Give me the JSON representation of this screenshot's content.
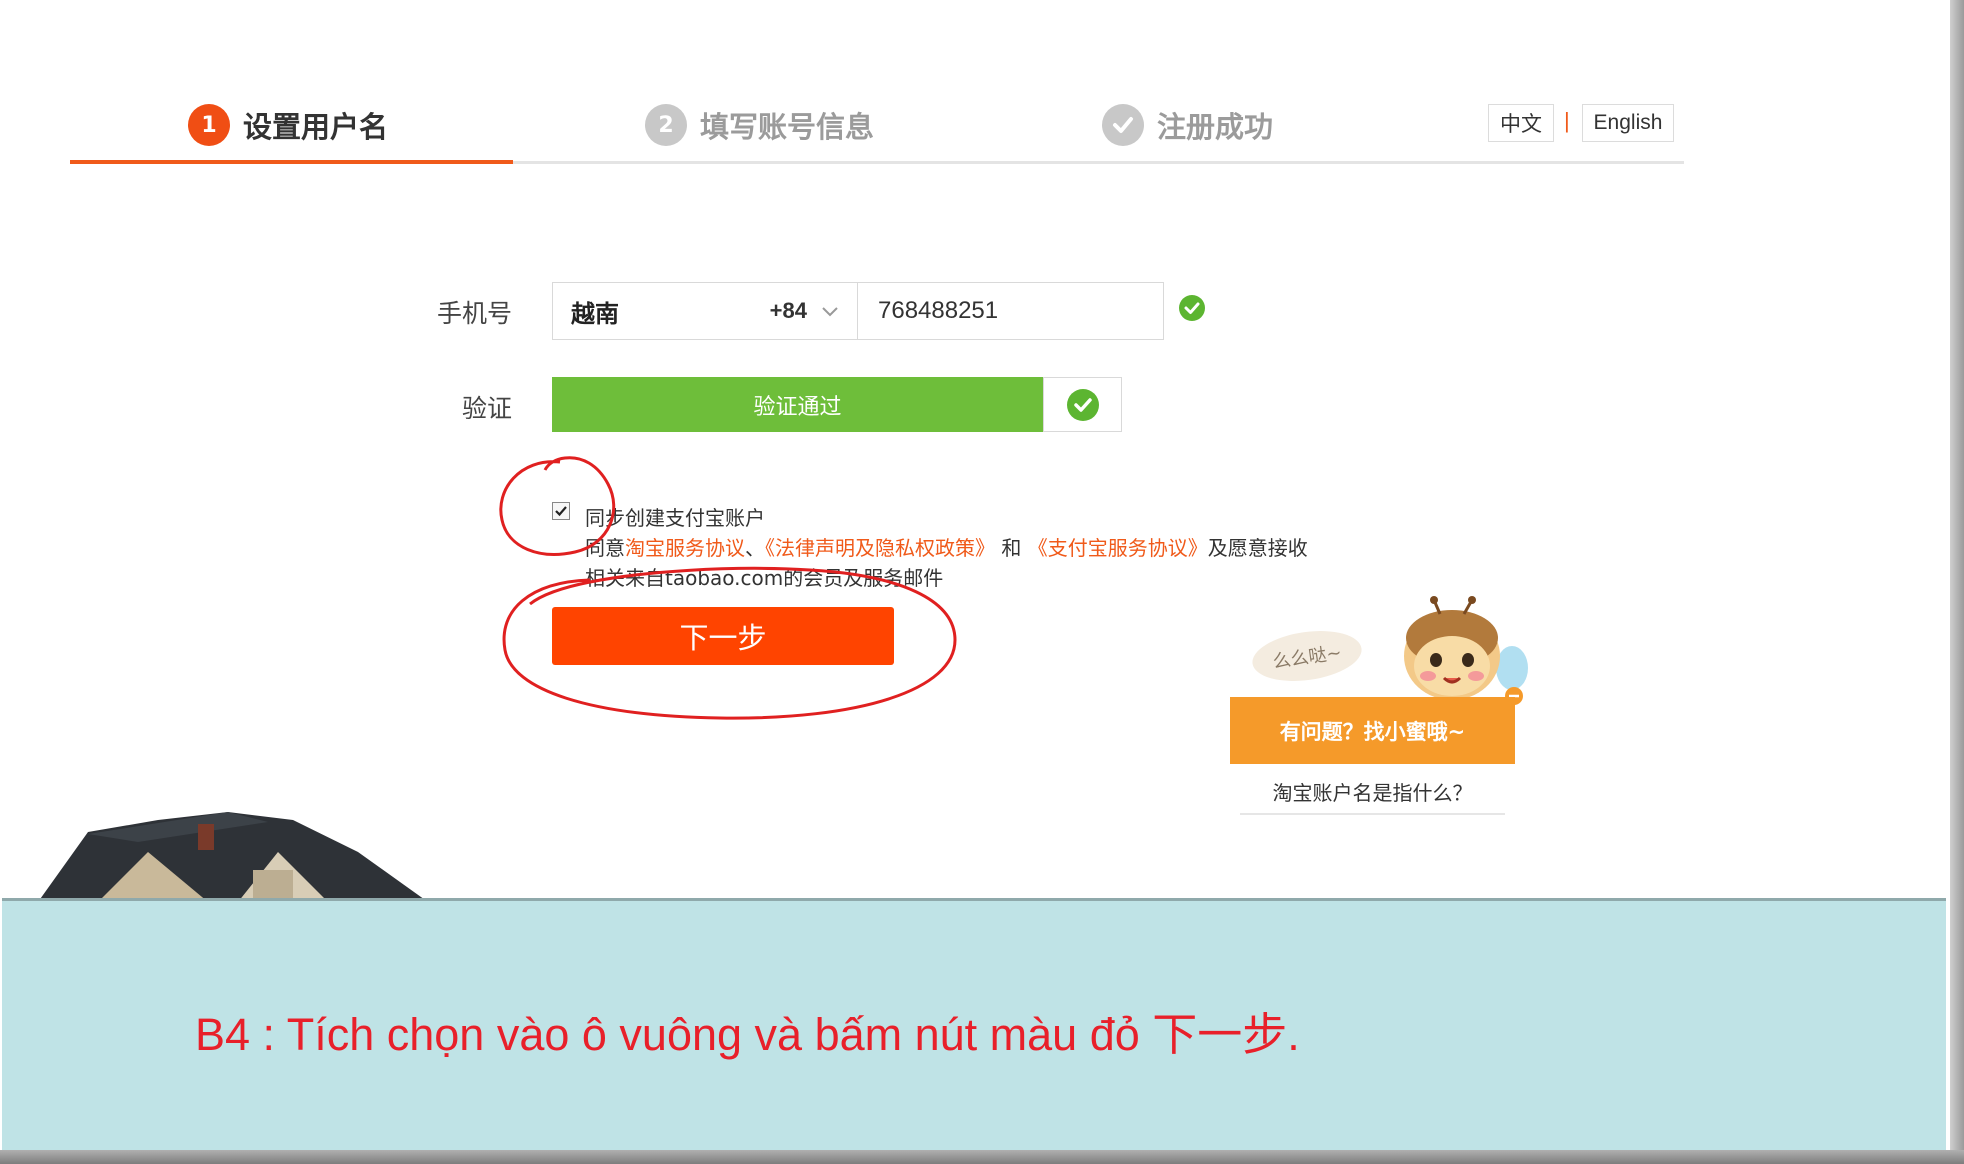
{
  "steps": [
    {
      "number": "1",
      "label": "设置用户名"
    },
    {
      "number": "2",
      "label": "填写账号信息"
    },
    {
      "number": "",
      "label": "注册成功"
    }
  ],
  "language": {
    "zh": "中文",
    "separator": "|",
    "en": "English"
  },
  "form": {
    "phone_label": "手机号",
    "country": "越南",
    "country_code": "+84",
    "phone_value": "768488251",
    "verify_label": "验证",
    "verify_status": "验证通过",
    "alipay_checked": true,
    "alipay_label": "同步创建支付宝账户",
    "agree_prefix": "同意",
    "agree_link_1": "淘宝服务协议",
    "agree_sep": "、",
    "agree_link_2": "《法律声明及隐私权政策》",
    "agree_and": " 和 ",
    "agree_link_3": "《支付宝服务协议》",
    "agree_suffix": "及愿意接收",
    "agree_line_3": "相关来自taobao.com的会员及服务邮件",
    "next_label": "下一步"
  },
  "help": {
    "bubble": "么么哒~",
    "banner": "有问题？找小蜜哦~",
    "link": "淘宝账户名是指什么？"
  },
  "caption": "B4 : Tích chọn vào ô vuông và bấm nút màu đỏ 下一步.",
  "colors": {
    "accent": "#f05a1a",
    "next_button": "#ff4400",
    "verify_green": "#6ebe3a",
    "caption_text": "#e8202a",
    "caption_bg": "#bfe3e6",
    "help_orange": "#f59a2a"
  },
  "icons": [
    "chevron-down-icon",
    "check-circle-icon",
    "checkbox-check-icon",
    "bee-mascot-icon"
  ]
}
